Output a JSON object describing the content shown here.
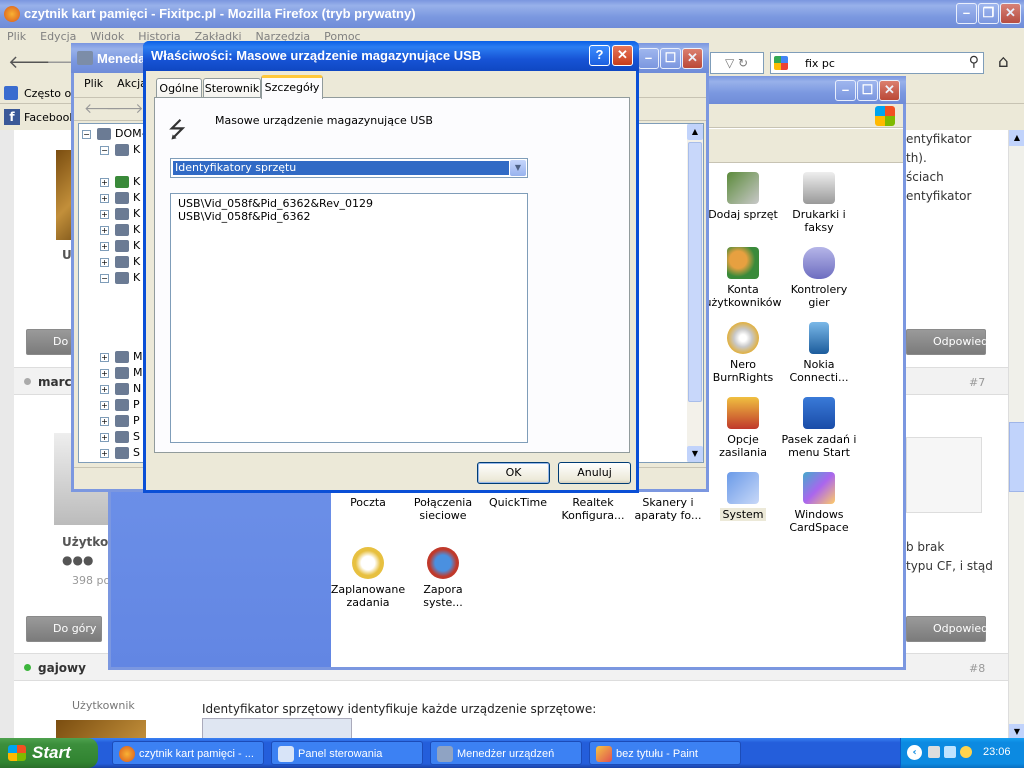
{
  "firefox": {
    "title": "czytnik kart pamięci - Fixitpc.pl - Mozilla Firefox (tryb prywatny)",
    "menu": [
      "Plik",
      "Edycja",
      "Widok",
      "Historia",
      "Zakładki",
      "Narzędzia",
      "Pomoc"
    ],
    "search_value": "fix pc",
    "bookmarks": [
      "Często od",
      "Facebook"
    ]
  },
  "forum": {
    "right_text": [
      "entyfikator",
      "th).",
      "ściach",
      "entyfikator"
    ],
    "right_text2": [
      "b brak",
      "typu CF, i stąd"
    ],
    "post7_number": "#7",
    "post7_user": "marc",
    "post7_rank": "Użytkow",
    "post7_posts": "398 po",
    "post8_user": "gajowy",
    "post8_number": "#8",
    "post8_rank": "Użytkownik",
    "post8_text": "Identyfikator sprzętowy identyfikuje każde urządzenie sprzętowe:",
    "btn_top": "Do góry",
    "btn_top_short": "Do g",
    "btn_reply": "Odpowiedz",
    "left_letter": "U"
  },
  "devmgr": {
    "title": "Meneda",
    "menu": [
      "Plik",
      "Akcja"
    ],
    "tree_root": "DOM-",
    "tree_items": [
      "K",
      "K",
      "K",
      "K",
      "K",
      "K",
      "K",
      "K",
      "K",
      "M",
      "M",
      "N",
      "P",
      "P",
      "S",
      "S"
    ]
  },
  "controlpanel": {
    "items": [
      {
        "label": "Dodaj sprzęt"
      },
      {
        "label": "Drukarki i faksy"
      },
      {
        "label": "Konta użytkowników"
      },
      {
        "label": "Kontrolery gier"
      },
      {
        "label": "Nero BurnRights"
      },
      {
        "label": "Nokia Connecti..."
      },
      {
        "label": "Opcje zasilania"
      },
      {
        "label": "Pasek zadań i menu Start"
      },
      {
        "label": "Poczta"
      },
      {
        "label": "Połączenia sieciowe"
      },
      {
        "label": "QuickTime"
      },
      {
        "label": "Realtek Konfigura..."
      },
      {
        "label": "Skanery i aparaty fo..."
      },
      {
        "label": "System"
      },
      {
        "label": "Windows CardSpace"
      },
      {
        "label": "Zaplanowane zadania"
      },
      {
        "label": "Zapora syste..."
      }
    ]
  },
  "dialog": {
    "title": "Właściwości: Masowe urządzenie magazynujące USB",
    "help_btn": "?",
    "close_btn": "✕",
    "tabs": [
      "Ogólne",
      "Sterownik",
      "Szczegóły"
    ],
    "device_name": "Masowe urządzenie magazynujące USB",
    "property_select": "Identyfikatory sprzętu",
    "values": [
      "USB\\Vid_058f&Pid_6362&Rev_0129",
      "USB\\Vid_058f&Pid_6362"
    ],
    "ok": "OK",
    "cancel": "Anuluj"
  },
  "taskbar": {
    "start": "Start",
    "tasks": [
      {
        "label": "czytnik kart pamięci - ..."
      },
      {
        "label": "Panel sterowania"
      },
      {
        "label": "Menedżer urządzeń"
      },
      {
        "label": "bez tytułu - Paint"
      }
    ],
    "clock": "23:06"
  }
}
